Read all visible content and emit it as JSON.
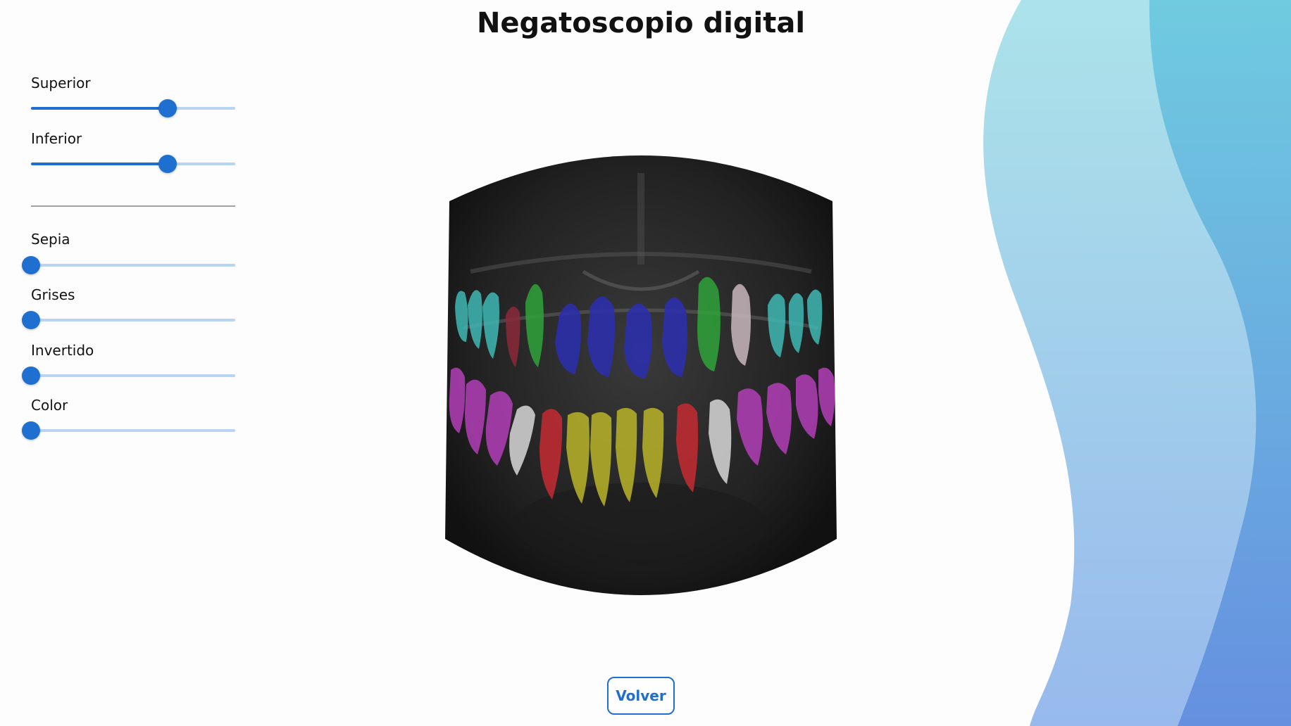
{
  "page": {
    "title": "Negatoscopio digital"
  },
  "sliders": [
    {
      "label": "Superior",
      "value": 0.67
    },
    {
      "label": "Inferior",
      "value": 0.67
    },
    {
      "label": "Sepia",
      "value": 0
    },
    {
      "label": "Grises",
      "value": 0
    },
    {
      "label": "Invertido",
      "value": 0
    },
    {
      "label": "Color",
      "value": 0
    }
  ],
  "actions": {
    "back_label": "Volver"
  },
  "colors": {
    "accent": "#1e6fd0",
    "track": "#b9d4f2",
    "wave_light": "#a8dfea",
    "wave_dark": "#6b93e0",
    "teeth": [
      "#3fb8b4",
      "#8a2a3a",
      "#2fa33a",
      "#2b2fb0",
      "#c9b7bd",
      "#b33fb8",
      "#d8d8d8",
      "#c62b33",
      "#b9b429"
    ]
  },
  "icons": {
    "xray": "panoramic-dental-xray"
  }
}
